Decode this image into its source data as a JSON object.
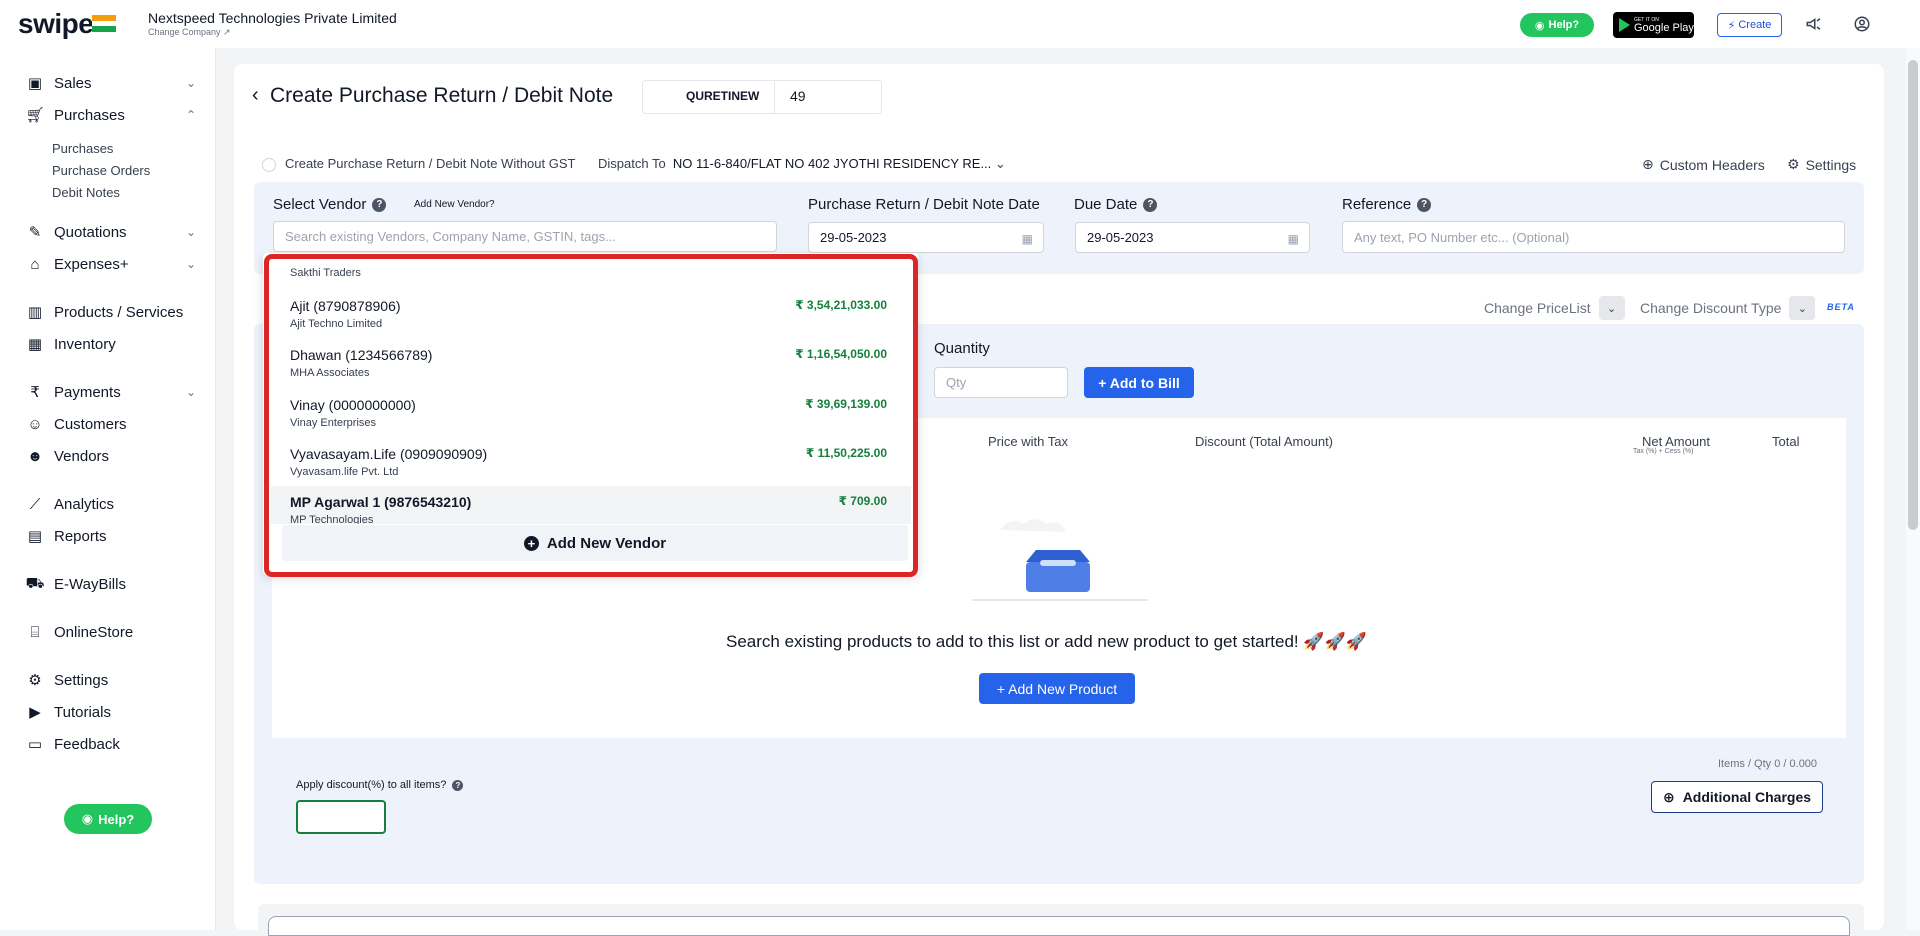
{
  "app": {
    "logo": "swipe",
    "company_name": "Nextspeed Technologies Private Limited",
    "change_company": "Change Company ↗"
  },
  "topbar": {
    "help": "Help?",
    "gplay_small": "GET IT ON",
    "gplay_big": "Google Play",
    "create": "Create"
  },
  "sidebar": {
    "items": [
      {
        "label": "Sales",
        "icon": "sales-icon",
        "chevron": "⌄"
      },
      {
        "label": "Purchases",
        "icon": "cart-icon",
        "chevron": "⌃"
      },
      {
        "label": "Quotations",
        "icon": "pen-icon",
        "chevron": "⌄"
      },
      {
        "label": "Expenses+",
        "icon": "tag-icon",
        "chevron": "⌄"
      },
      {
        "label": "Products / Services",
        "icon": "barcode-icon"
      },
      {
        "label": "Inventory",
        "icon": "warehouse-icon"
      },
      {
        "label": "Payments",
        "icon": "rupee-icon",
        "chevron": "⌄"
      },
      {
        "label": "Customers",
        "icon": "user-icon"
      },
      {
        "label": "Vendors",
        "icon": "vendors-icon"
      },
      {
        "label": "Analytics",
        "icon": "chart-icon"
      },
      {
        "label": "Reports",
        "icon": "report-icon"
      },
      {
        "label": "E-WayBills",
        "icon": "truck-icon"
      },
      {
        "label": "OnlineStore",
        "icon": "store-icon"
      },
      {
        "label": "Settings",
        "icon": "gear-icon"
      },
      {
        "label": "Tutorials",
        "icon": "video-icon"
      },
      {
        "label": "Feedback",
        "icon": "feedback-icon"
      }
    ],
    "purchases_sub": [
      "Purchases",
      "Purchase Orders",
      "Debit Notes"
    ],
    "help": "Help?"
  },
  "page": {
    "title": "Create Purchase Return / Debit Note",
    "number_prefix": "QURETINEW",
    "number_value": "49",
    "without_gst": "Create Purchase Return / Debit Note Without GST",
    "dispatch_label": "Dispatch To",
    "dispatch_value": "NO 11-6-840/FLAT NO 402 JYOTHI RESIDENCY RE...",
    "custom_headers": "Custom Headers",
    "settings": "Settings"
  },
  "form": {
    "vendor_label": "Select Vendor",
    "add_new_vendor_link": "Add New Vendor?",
    "vendor_placeholder": "Search existing Vendors, Company Name, GSTIN, tags...",
    "date_label": "Purchase Return / Debit Note Date",
    "date_value": "29-05-2023",
    "due_label": "Due Date",
    "due_value": "29-05-2023",
    "reference_label": "Reference",
    "reference_placeholder": "Any text, PO Number etc... (Optional)"
  },
  "pricing": {
    "change_pricelist": "Change PriceList",
    "change_discount": "Change Discount Type",
    "beta": "BETA"
  },
  "items": {
    "quantity_label": "Quantity",
    "qty_placeholder": "Qty",
    "add_to_bill": "+ Add to Bill",
    "columns": {
      "price_with_tax": "Price with Tax",
      "discount": "Discount (Total Amount)",
      "net_amount": "Net Amount",
      "net_amount_sub": "Tax (%) + Cess (%)",
      "total": "Total"
    },
    "empty_text": "Search existing products to add to this list or add new product to get started! 🚀🚀🚀",
    "add_new_product": "+ Add New Product",
    "items_qty": "Items / Qty 0 / 0.000",
    "apply_discount": "Apply discount(%) to all items?",
    "additional_charges": "Additional Charges"
  },
  "dropdown": {
    "header": "Sakthi Traders",
    "items": [
      {
        "name": "Ajit (8790878906)",
        "company": "Ajit Techno Limited",
        "amount": "₹ 3,54,21,033.00"
      },
      {
        "name": "Dhawan (1234566789)",
        "company": "MHA Associates",
        "amount": "₹ 1,16,54,050.00"
      },
      {
        "name": "Vinay (0000000000)",
        "company": "Vinay Enterprises",
        "amount": "₹ 39,69,139.00"
      },
      {
        "name": "Vyavasayam.Life (0909090909)",
        "company": "Vyavasam.life Pvt. Ltd",
        "amount": "₹ 11,50,225.00"
      },
      {
        "name": "MP Agarwal 1 (9876543210)",
        "company": "MP Technologies",
        "amount": "₹ 709.00"
      }
    ],
    "add_new_vendor": "Add New Vendor"
  },
  "colors": {
    "primary": "#2563eb",
    "success": "#22c55e",
    "amount_green": "#15803d",
    "highlight_red": "#dc2626"
  }
}
